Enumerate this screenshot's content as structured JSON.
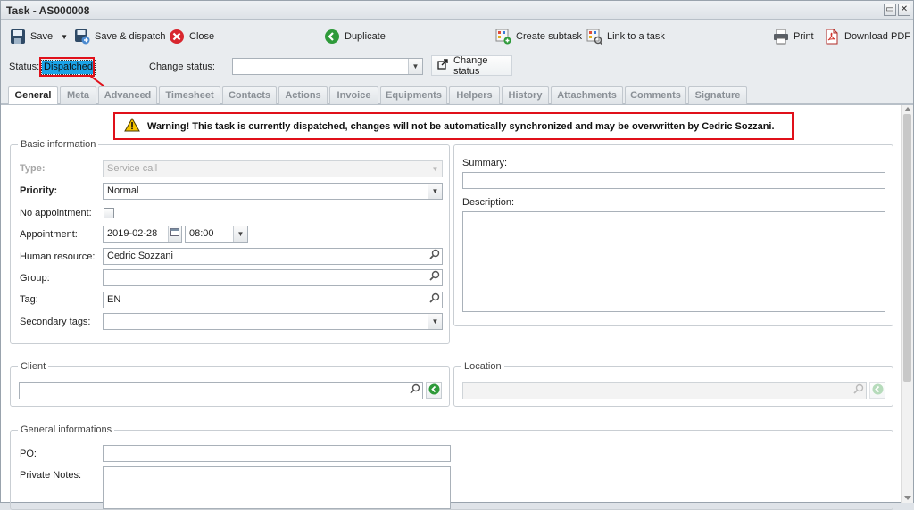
{
  "window": {
    "title": "Task - AS000008"
  },
  "toolbar": {
    "save_label": "Save",
    "save_dispatch_label": "Save & dispatch",
    "close_label": "Close",
    "duplicate_label": "Duplicate",
    "create_subtask_label": "Create subtask",
    "link_task_label": "Link to a task",
    "print_label": "Print",
    "download_pdf_label": "Download PDF"
  },
  "status": {
    "label": "Status:",
    "value": "Dispatched",
    "change_label": "Change status:",
    "change_value": "",
    "change_button": "Change status"
  },
  "tabs": [
    {
      "label": "General",
      "active": true
    },
    {
      "label": "Meta"
    },
    {
      "label": "Advanced"
    },
    {
      "label": "Timesheet"
    },
    {
      "label": "Contacts"
    },
    {
      "label": "Actions"
    },
    {
      "label": "Invoice"
    },
    {
      "label": "Equipments"
    },
    {
      "label": "Helpers"
    },
    {
      "label": "History"
    },
    {
      "label": "Attachments"
    },
    {
      "label": "Comments"
    },
    {
      "label": "Signature"
    }
  ],
  "warning": {
    "text": "Warning! This task is currently dispatched, changes will not be automatically synchronized and may be overwritten by Cedric Sozzani."
  },
  "basic": {
    "legend": "Basic information",
    "type_label": "Type:",
    "type_value": "Service call",
    "priority_label": "Priority:",
    "priority_value": "Normal",
    "no_appointment_label": "No appointment:",
    "no_appointment_checked": false,
    "appointment_label": "Appointment:",
    "appointment_date": "2019-02-28",
    "appointment_time": "08:00",
    "human_resource_label": "Human resource:",
    "human_resource_value": "Cedric Sozzani",
    "group_label": "Group:",
    "group_value": "",
    "tag_label": "Tag:",
    "tag_value": "EN",
    "secondary_tags_label": "Secondary tags:",
    "secondary_tags_value": ""
  },
  "summary": {
    "summary_label": "Summary:",
    "summary_value": "",
    "description_label": "Description:",
    "description_value": ""
  },
  "client": {
    "legend": "Client",
    "value": ""
  },
  "location": {
    "legend": "Location",
    "value": ""
  },
  "general_info": {
    "legend": "General informations",
    "po_label": "PO:",
    "po_value": "",
    "private_notes_label": "Private Notes:",
    "private_notes_value": ""
  },
  "colors": {
    "status_highlight": "#1aa3e8",
    "callout_red": "#e0101a"
  }
}
